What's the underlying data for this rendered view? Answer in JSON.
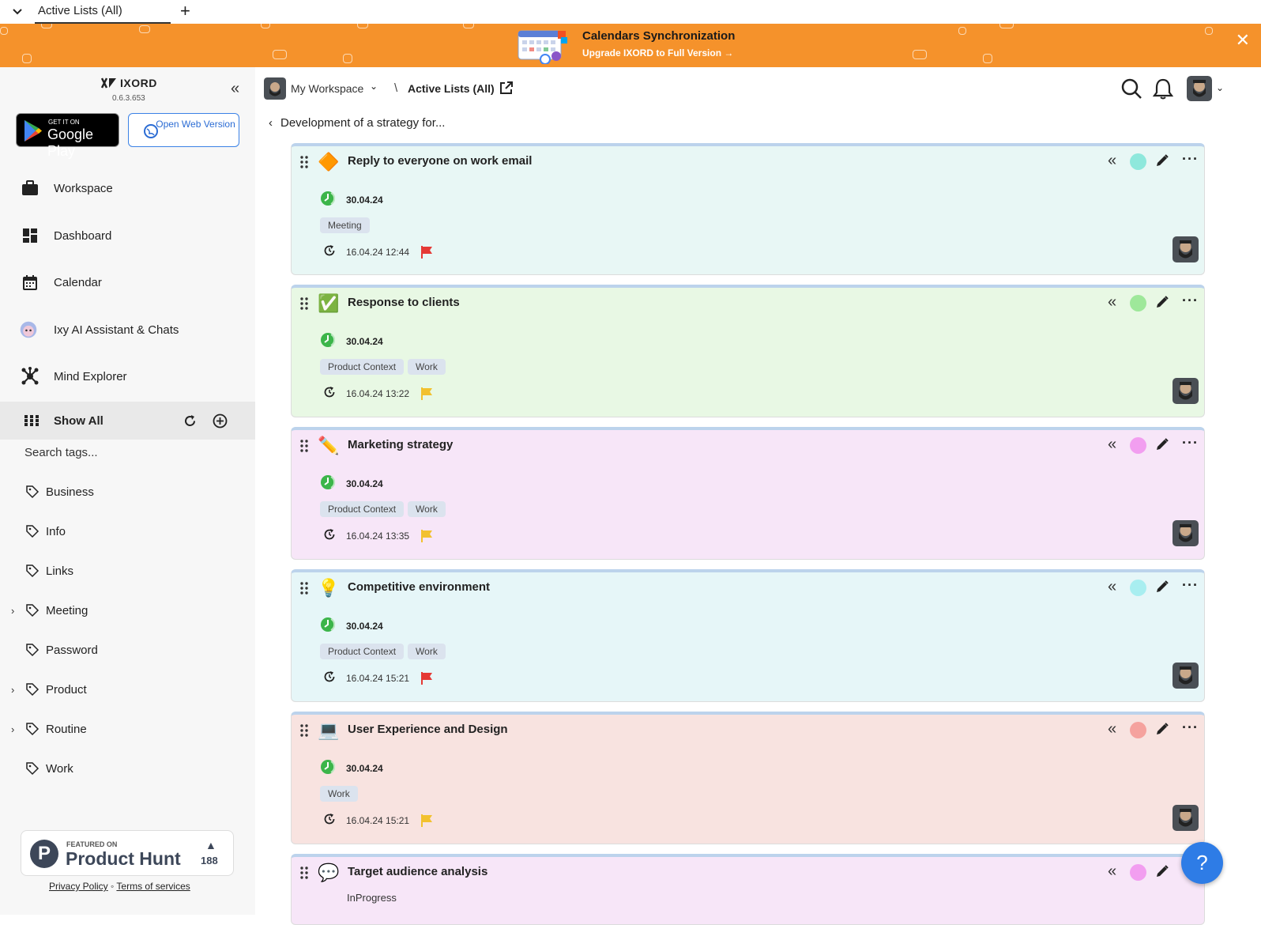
{
  "tabbar": {
    "active_tab": "Active Lists (All)",
    "add": "+"
  },
  "banner": {
    "title": "Calendars Synchronization",
    "link": "Upgrade IXORD to Full Version →",
    "close": "✕"
  },
  "sidebar": {
    "logo": "IXORD",
    "version": "0.6.3.653",
    "google_play": {
      "small": "GET IT ON",
      "big": "Google Play"
    },
    "web_button": "Open Web Version",
    "nav": [
      {
        "label": "Workspace",
        "icon": "briefcase-icon"
      },
      {
        "label": "Dashboard",
        "icon": "dashboard-icon"
      },
      {
        "label": "Calendar",
        "icon": "calendar-icon"
      },
      {
        "label": "Ixy AI Assistant & Chats",
        "icon": "ai-assistant-icon"
      },
      {
        "label": "Mind Explorer",
        "icon": "mind-explorer-icon"
      }
    ],
    "show_all": "Show All",
    "search_tags": "Search tags...",
    "tags": [
      {
        "label": "Business",
        "expandable": false
      },
      {
        "label": "Info",
        "expandable": false
      },
      {
        "label": "Links",
        "expandable": false
      },
      {
        "label": "Meeting",
        "expandable": true
      },
      {
        "label": "Password",
        "expandable": false
      },
      {
        "label": "Product",
        "expandable": true
      },
      {
        "label": "Routine",
        "expandable": true
      },
      {
        "label": "Work",
        "expandable": false
      }
    ],
    "product_hunt": {
      "featured": "FEATURED ON",
      "name": "Product Hunt",
      "count": "188"
    },
    "legal": {
      "privacy": "Privacy Policy",
      "sep": "◦",
      "terms": "Terms of services"
    }
  },
  "header": {
    "workspace": "My Workspace",
    "separator": "\\",
    "current": "Active Lists (All)"
  },
  "back_label": "Development of a strategy for...",
  "cards": [
    {
      "title": "Reply to everyone on work email",
      "emoji": "🔶",
      "bg": "#e8f7f5",
      "dot": "#8ee8dc",
      "due": "30.04.24",
      "tags": [
        "Meeting"
      ],
      "created": "16.04.24 12:44",
      "flag": "#e53935"
    },
    {
      "title": "Response to clients",
      "emoji": "✅",
      "bg": "#e8f8e4",
      "dot": "#9ee89a",
      "due": "30.04.24",
      "tags": [
        "Product Context",
        "Work"
      ],
      "created": "16.04.24 13:22",
      "flag": "#f2c12e"
    },
    {
      "title": "Marketing strategy",
      "emoji": "✏️",
      "bg": "#f7e6f8",
      "dot": "#f29ef0",
      "due": "30.04.24",
      "tags": [
        "Product Context",
        "Work"
      ],
      "created": "16.04.24 13:35",
      "flag": "#f2c12e"
    },
    {
      "title": "Competitive environment",
      "emoji": "💡",
      "bg": "#e6f6f8",
      "dot": "#a8eef0",
      "due": "30.04.24",
      "tags": [
        "Product Context",
        "Work"
      ],
      "created": "16.04.24 15:21",
      "flag": "#e53935"
    },
    {
      "title": "User Experience and Design",
      "emoji": "💻",
      "bg": "#f8e3e0",
      "dot": "#f5a29e",
      "due": "30.04.24",
      "tags": [
        "Work"
      ],
      "created": "16.04.24 15:21",
      "flag": "#f2c12e"
    },
    {
      "title": "Target audience analysis",
      "emoji": "💬",
      "bg": "#f7e6f8",
      "dot": "#f29ef0",
      "status": "InProgress"
    }
  ],
  "help": "?"
}
